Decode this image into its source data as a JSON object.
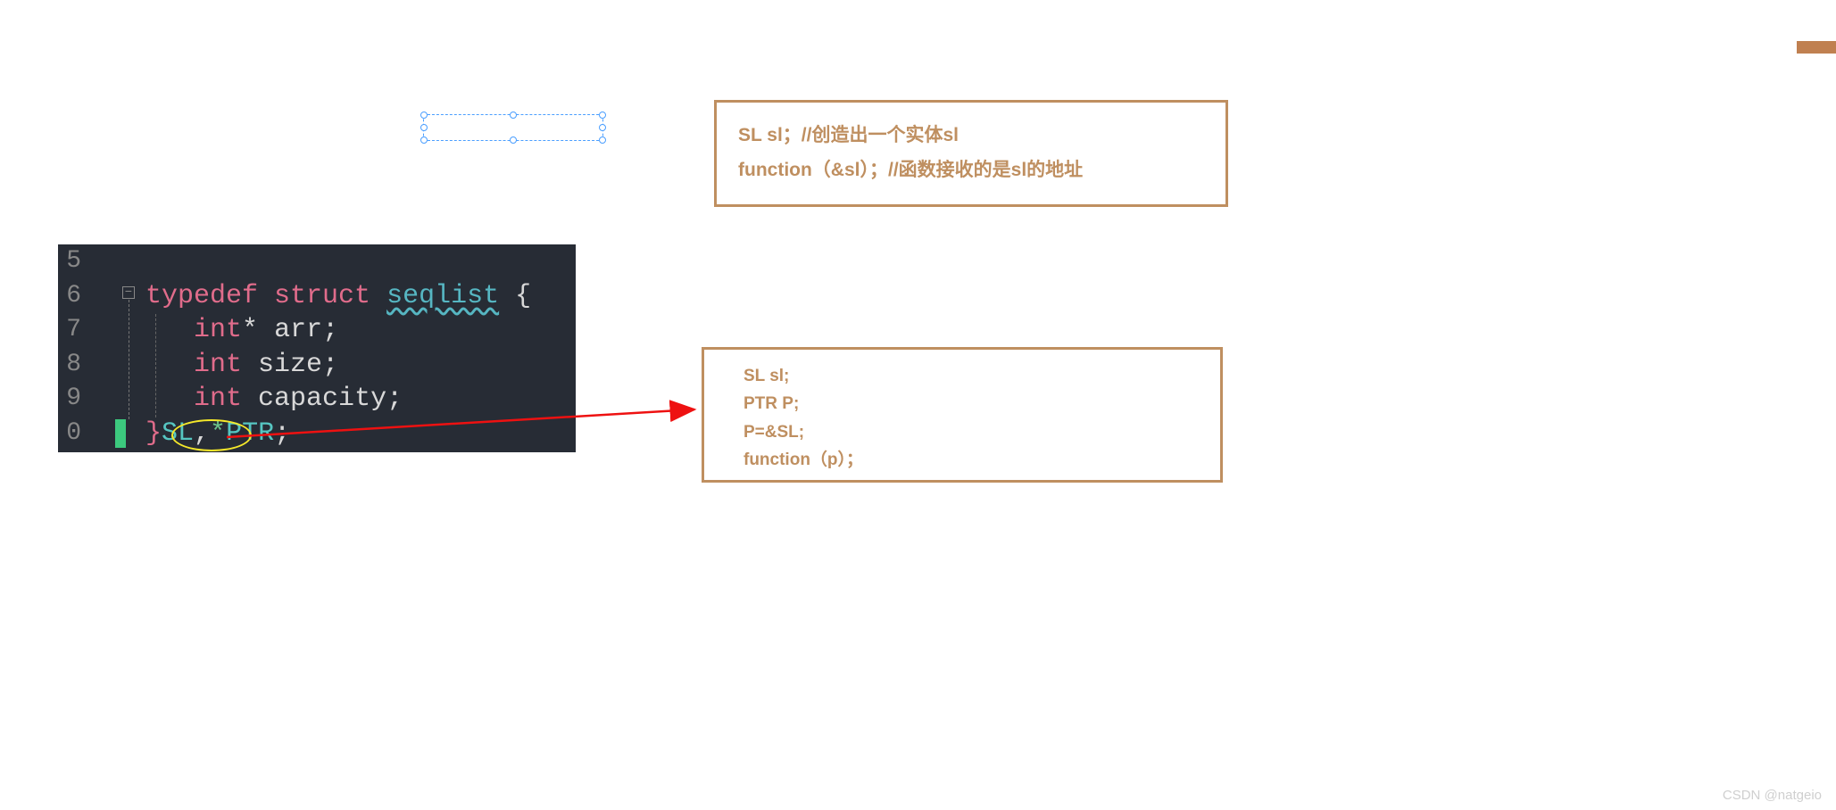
{
  "box_top": {
    "line1": "SL sl；//创造出一个实体sl",
    "line2": "function（&sl）；//函数接收的是sl的地址"
  },
  "box_bottom": {
    "line1": "SL sl;",
    "line2": "PTR P;",
    "line3": "P=&SL;",
    "line4": "function（p）；"
  },
  "code": {
    "line_numbers": [
      "5",
      "6",
      "7",
      "8",
      "9",
      "0"
    ],
    "l6": {
      "kw1": "typedef",
      "kw2": "struct",
      "ident": "seqlist",
      "brace": "{"
    },
    "l7": {
      "type": "int",
      "star": "*",
      "name": "arr",
      "semi": ";"
    },
    "l8": {
      "type": "int",
      "name": "size",
      "semi": ";"
    },
    "l9": {
      "type": "int",
      "name": "capacity",
      "semi": ";"
    },
    "l10": {
      "rbrace": "}",
      "t1": "SL",
      "comma": ",",
      "star": "*",
      "t2": "PTR",
      "semi": ";"
    }
  },
  "watermark": "CSDN @natgeio"
}
